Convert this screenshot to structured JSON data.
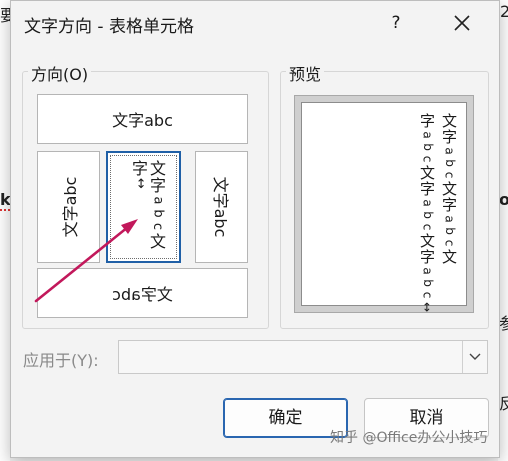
{
  "background_fragments": [
    "要",
    "k",
    "o",
    "2",
    "参",
    "反"
  ],
  "dialog": {
    "title": "文字方向 - 表格单元格",
    "help": "?",
    "close_icon": "close-icon"
  },
  "orientation": {
    "label": "方向(O)",
    "options": {
      "horizontal": "文字abc",
      "vertical_left": "文字abc",
      "stacked_col1": [
        "文",
        "字",
        "a",
        "b",
        "c",
        "文"
      ],
      "stacked_col2": [
        "字",
        "↔"
      ],
      "vertical_right": "文字abc",
      "bottom": "文字abc"
    },
    "selected": "stacked"
  },
  "preview": {
    "label": "预览",
    "col1": [
      "文",
      "字",
      "a",
      "b",
      "c",
      "文",
      "字",
      "a",
      "b",
      "c",
      "文"
    ],
    "col2": [
      "字",
      "a",
      "b",
      "c",
      "文",
      "字",
      "a",
      "b",
      "c",
      "文",
      "字",
      "a",
      "b",
      "c",
      "↔"
    ]
  },
  "apply": {
    "label": "应用于(Y):",
    "value": ""
  },
  "buttons": {
    "ok": "确定",
    "cancel": "取消"
  },
  "watermark": "知乎 @Office办公小技巧",
  "colors": {
    "selection_border": "#1f5fa6",
    "arrow": "#c2185b"
  }
}
